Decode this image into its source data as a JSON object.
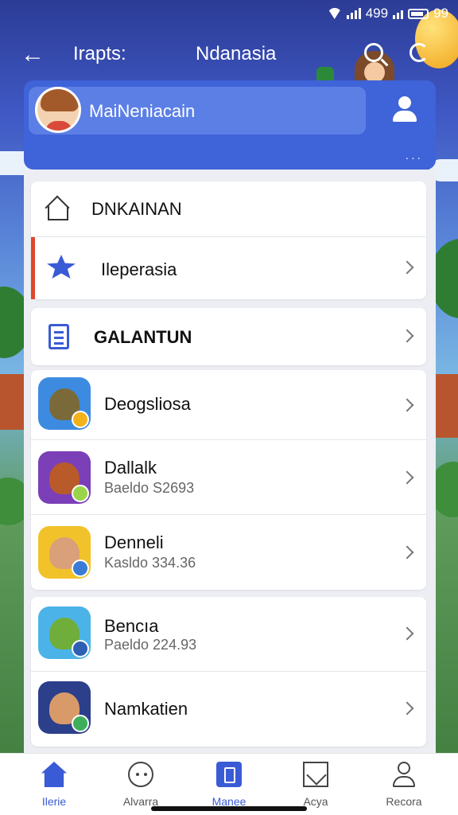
{
  "status_bar": {
    "signal_text": "499",
    "battery_text": "99"
  },
  "topbar": {
    "title_left": "Irapts:",
    "title": "Ndanasia"
  },
  "profile": {
    "name": "MaiNeniacain",
    "more": "..."
  },
  "menu": [
    {
      "label": "DNKAINAN",
      "icon": "home-icon"
    },
    {
      "label": "Ileperasia",
      "icon": "star-icon"
    },
    {
      "label": "GALANTUN",
      "icon": "document-icon"
    }
  ],
  "apps": [
    {
      "name": "Deogsliosa",
      "sub": "",
      "icon": "robot-game-icon",
      "color": "#3d8be0",
      "fig_color": "#7a6a3a",
      "badge": "#f2b21c"
    },
    {
      "name": "Dallalk",
      "sub": "Baeldo S2693",
      "icon": "bear-game-icon",
      "color": "#7b3fb8",
      "fig_color": "#b85a2a",
      "badge": "#9bd44a"
    },
    {
      "name": "Denneli",
      "sub": "Kasldo 334.36",
      "icon": "boy-game-icon",
      "color": "#f2c22a",
      "fig_color": "#d9a07a",
      "badge": "#3a7bd5"
    },
    {
      "name": "Bencıa",
      "sub": "Paeldo 224.93",
      "icon": "cat-game-icon",
      "color": "#4cb3e8",
      "fig_color": "#6fae3a",
      "badge": "#2e5fb3"
    },
    {
      "name": "Namkatien",
      "sub": "",
      "icon": "girl-game-icon",
      "color": "#2c3f8a",
      "fig_color": "#d99a6a",
      "badge": "#3fae5a"
    }
  ],
  "tabs": [
    {
      "label": "Ilerie",
      "icon": "home-icon",
      "active": true
    },
    {
      "label": "Alvarra",
      "icon": "face-icon",
      "active": false
    },
    {
      "label": "Manee",
      "icon": "document-icon",
      "active": true
    },
    {
      "label": "Acya",
      "icon": "box-icon",
      "active": false
    },
    {
      "label": "Recora",
      "icon": "user-icon",
      "active": false
    }
  ]
}
